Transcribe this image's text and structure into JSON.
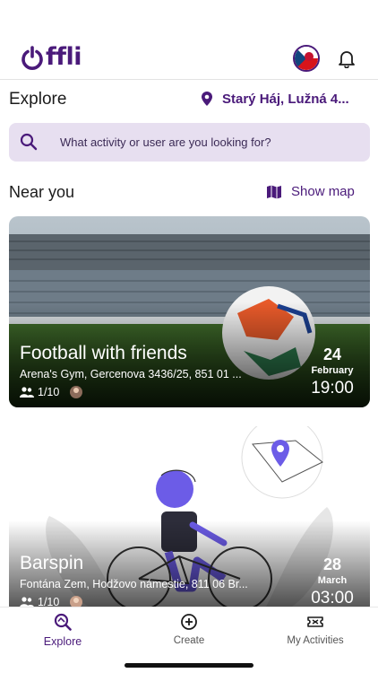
{
  "app": {
    "logo_text": "ffli",
    "logo_icon": "power-icon"
  },
  "header": {
    "explore_title": "Explore",
    "location": "Starý Háj, Lužná 4...",
    "search_placeholder": "What activity or user are you looking for?"
  },
  "near": {
    "title": "Near you",
    "show_map": "Show map"
  },
  "activities": [
    {
      "title": "Football with friends",
      "address": "Arena's Gym, Gercenova 3436/25, 851 01 ...",
      "participants": "1/10",
      "day": "24",
      "month": "February",
      "time": "19:00"
    },
    {
      "title": "Barspin",
      "address": "Fontána Zem, Hodžovo námestie, 811 06 Br...",
      "participants": "1/10",
      "day": "28",
      "month": "March",
      "time": "03:00"
    }
  ],
  "tabs": [
    {
      "label": "Explore",
      "icon": "explore-search-icon",
      "active": true
    },
    {
      "label": "Create",
      "icon": "add-circle-icon",
      "active": false
    },
    {
      "label": "My Activities",
      "icon": "ticket-icon",
      "active": false
    }
  ],
  "colors": {
    "brand": "#4a1a7a",
    "search_bg": "#e7dff0",
    "accent_illustration": "#6c5ce7"
  }
}
